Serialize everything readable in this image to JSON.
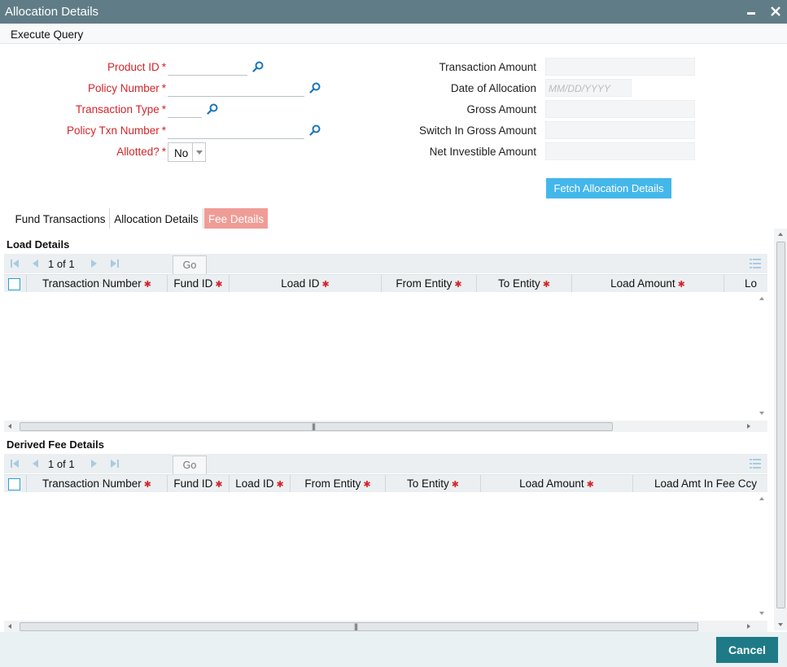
{
  "window": {
    "title": "Allocation Details"
  },
  "menu": {
    "execute_query": "Execute Query"
  },
  "form": {
    "product_id_label": "Product ID",
    "policy_number_label": "Policy Number",
    "transaction_type_label": "Transaction Type",
    "policy_txn_number_label": "Policy Txn Number",
    "allotted_label": "Allotted?",
    "allotted_value": "No",
    "required_mark": "*",
    "transaction_amount_label": "Transaction Amount",
    "date_of_allocation_label": "Date of Allocation",
    "date_placeholder": "MM/DD/YYYY",
    "gross_amount_label": "Gross Amount",
    "switch_in_gross_label": "Switch In Gross Amount",
    "net_investible_label": "Net Investible Amount",
    "fetch_button": "Fetch Allocation Details"
  },
  "tabs": [
    {
      "label": "Fund Transactions",
      "active": false
    },
    {
      "label": "Allocation Details",
      "active": false
    },
    {
      "label": "Fee Details",
      "active": true
    }
  ],
  "load_details": {
    "title": "Load Details",
    "pager_current": "1",
    "pager_of": "of",
    "pager_total": "1",
    "go_label": "Go",
    "columns": [
      {
        "label": "Transaction Number",
        "required": true
      },
      {
        "label": "Fund ID",
        "required": true
      },
      {
        "label": "Load ID",
        "required": true
      },
      {
        "label": "From Entity",
        "required": true
      },
      {
        "label": "To Entity",
        "required": true
      },
      {
        "label": "Load Amount",
        "required": true
      },
      {
        "label": "Lo",
        "required": false
      }
    ],
    "rows": []
  },
  "derived_fee_details": {
    "title": "Derived Fee Details",
    "pager_current": "1",
    "pager_of": "of",
    "pager_total": "1",
    "go_label": "Go",
    "columns": [
      {
        "label": "Transaction Number",
        "required": true
      },
      {
        "label": "Fund ID",
        "required": true
      },
      {
        "label": "Load ID",
        "required": true
      },
      {
        "label": "From Entity",
        "required": true
      },
      {
        "label": "To Entity",
        "required": true
      },
      {
        "label": "Load Amount",
        "required": true
      },
      {
        "label": "Load Amt In Fee Ccy",
        "required": false
      }
    ],
    "rows": []
  },
  "footer": {
    "cancel": "Cancel"
  },
  "colors": {
    "title_bar": "#607d87",
    "required_label": "#d4252a",
    "accent_button": "#44b7ea",
    "active_tab": "#f09c96",
    "cancel_button": "#1e7a87",
    "search_icon": "#1976b8"
  }
}
